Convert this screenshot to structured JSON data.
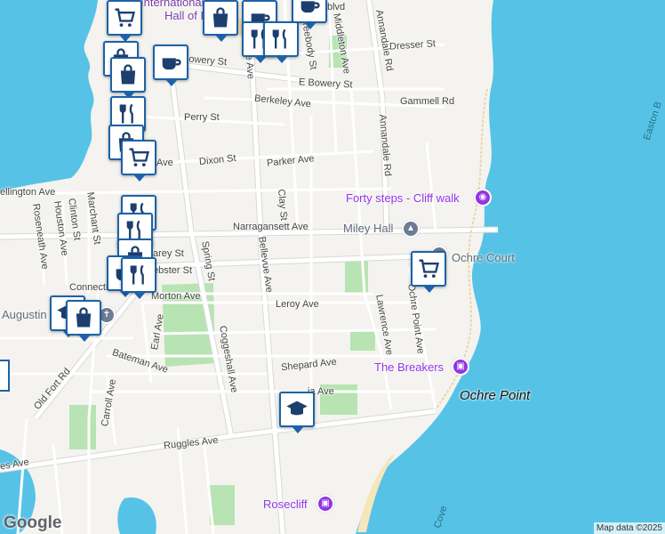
{
  "colors": {
    "water": "#56c3e6",
    "land": "#f4f3ef",
    "park": "#b7e4b2",
    "road": "#ffffff",
    "road_outline": "#d8d8d8",
    "marker_border": "#1c62a8",
    "poi_purple": "#9334e6",
    "poi_gray": "#6b7c93",
    "beach": "#f5e7bb"
  },
  "streets": {
    "international": "International",
    "hall_of_fame": "Hall of Fame",
    "fragment_blvd": "blvd",
    "bowery_st": "Bowery St",
    "e_bowery_st": "E Bowery St",
    "dresser_st": "Dresser St",
    "gammell_rd": "Gammell Rd",
    "berkeley_ave": "Berkeley Ave",
    "perry_st": "Perry St",
    "parker_ave": "Parker Ave",
    "dixon_st": "Dixon St",
    "clay_st": "Clay St",
    "fragment_ave": "Ave",
    "wellington_ave": "ellington Ave",
    "narragansett_ave": "Narragansett Ave",
    "carey_st": "arey St",
    "webster_st": "ebster St",
    "connection": "Connection",
    "morton_ave": "Morton Ave",
    "leroy_ave": "Leroy Ave",
    "lawrence_ave": "Lawrence Ave",
    "annandale_rd": "Annandale Rd",
    "annandale_rd_2": "Annandale Rd",
    "middleton_ave": "Middleton Ave",
    "freebody_st": "Freebody St",
    "bellevue_ave": "Bellevue Ave",
    "bellevue_ave_top": "ue Ave",
    "spring_st": "Spring St",
    "coggeshall_ave": "Coggeshall Ave",
    "roseneath_ave": "Roseneath Ave",
    "houston_ave": "Houston Ave",
    "clinton_st": "Clinton St",
    "marchant_st": "Marchant St",
    "earl_ave": "Earl Ave",
    "bateman_ave": "Bateman Ave",
    "carroll_ave": "Carroll Ave",
    "old_fort_rd": "Old Fort Rd",
    "shepard_ave": "Shepard Ave",
    "fragment_ave2": "ia Ave",
    "ochre_point_ave": "Ochre Point Ave",
    "ruggles_ave": "Ruggles Ave",
    "ruggles_ave_left": "es Ave"
  },
  "pois": {
    "forty_steps": "Forty steps - Cliff walk",
    "miley_hall": "Miley Hall",
    "ochre_court": "Ochre Court",
    "the_breakers": "The Breakers",
    "rosecliff": "Rosecliff",
    "augustin": "Augustin"
  },
  "places": {
    "ochre_point": "Ochre Point",
    "easton_bay": "Easton B",
    "cove": "Cove"
  },
  "markers": [
    {
      "icon": "shopping-cart",
      "label": "Shopping"
    },
    {
      "icon": "coffee-cup",
      "label": "Cafe"
    },
    {
      "icon": "fork-knife",
      "label": "Restaurant"
    },
    {
      "icon": "shopping-bag",
      "label": "Store"
    },
    {
      "icon": "graduation-cap",
      "label": "School"
    }
  ],
  "footer": {
    "logo": "Google",
    "attribution": "Map data ©2025"
  }
}
